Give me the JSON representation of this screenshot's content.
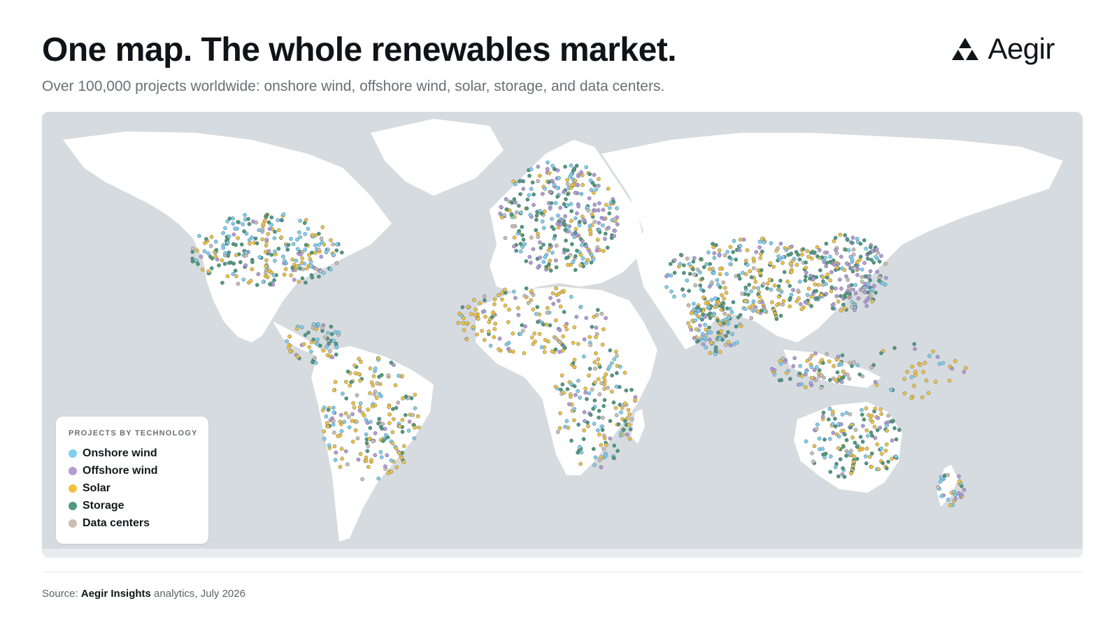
{
  "title": "One map. The whole renewables market.",
  "subtitle": "Over 100,000 projects worldwide: onshore wind, offshore wind, solar, storage, and data centers.",
  "brand": {
    "name": "Aegir",
    "icon": "triforce-triangle-icon"
  },
  "legend": {
    "title": "PROJECTS BY TECHNOLOGY",
    "items": [
      {
        "label": "Onshore wind",
        "color": "#7fd0f0"
      },
      {
        "label": "Offshore wind",
        "color": "#b59ad6"
      },
      {
        "label": "Solar",
        "color": "#f2c23d"
      },
      {
        "label": "Storage",
        "color": "#4e9a7c"
      },
      {
        "label": "Data centers",
        "color": "#cbbfb3"
      }
    ]
  },
  "colors": {
    "ocean": "#d6dbdf",
    "land": "#ffffff",
    "marker_stroke": "#5b6b78"
  },
  "source": {
    "prefix": "Source: ",
    "org": "Aegir Insights",
    "suffix": " analytics, July 2026"
  }
}
